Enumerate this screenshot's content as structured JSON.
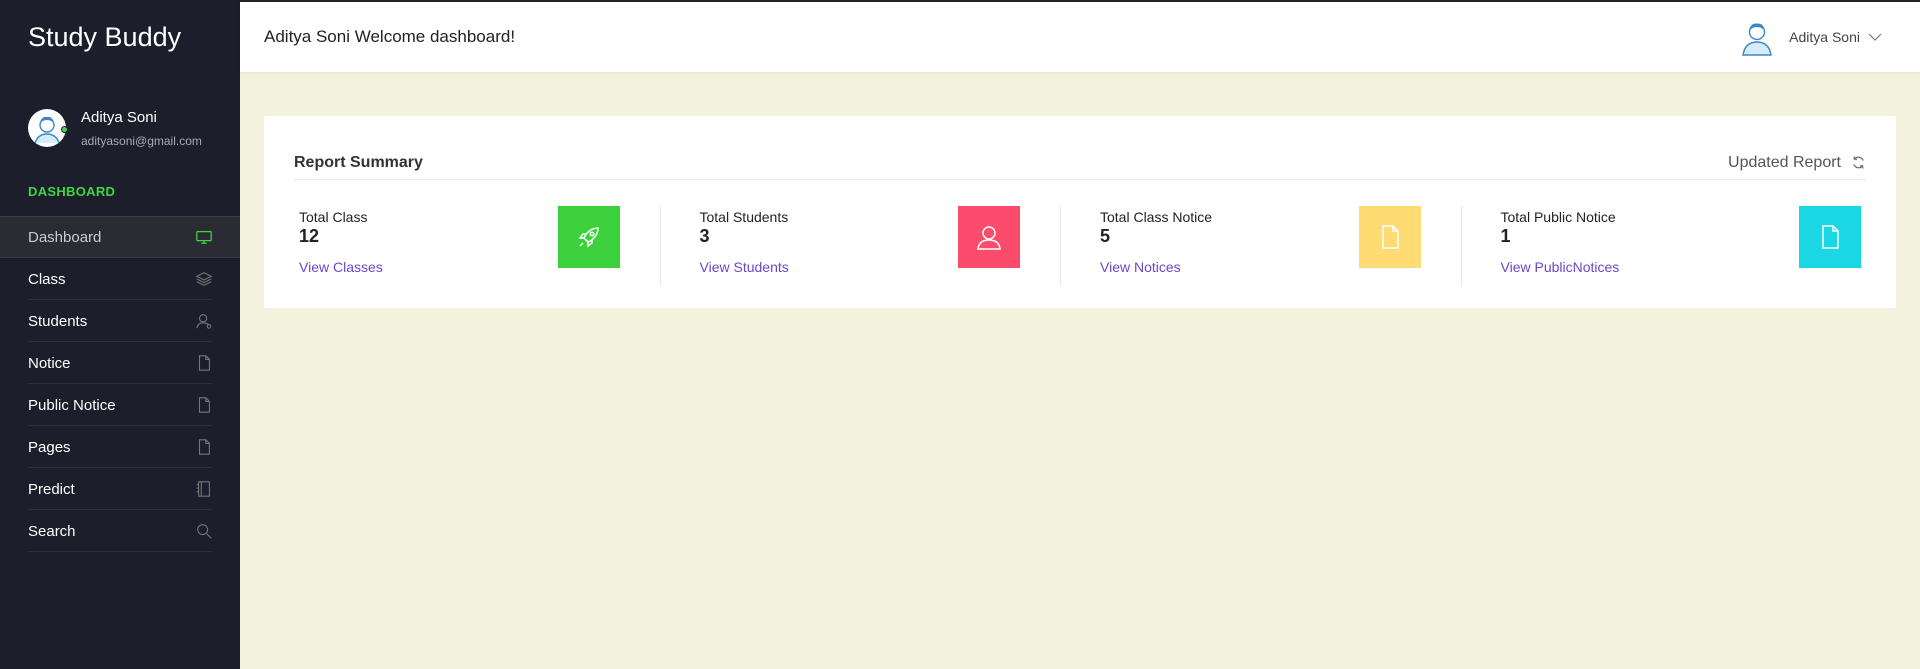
{
  "sidebar": {
    "brand": "Study Buddy",
    "profile": {
      "name": "Aditya Soni",
      "email": "adityasoni@gmail.com"
    },
    "section_label": "DASHBOARD",
    "items": [
      {
        "label": "Dashboard",
        "icon": "monitor-icon",
        "active": true
      },
      {
        "label": "Class",
        "icon": "layers-icon"
      },
      {
        "label": "Students",
        "icon": "user-icon"
      },
      {
        "label": "Notice",
        "icon": "document-icon"
      },
      {
        "label": "Public Notice",
        "icon": "document-icon"
      },
      {
        "label": "Pages",
        "icon": "document-icon"
      },
      {
        "label": "Predict",
        "icon": "notebook-icon"
      },
      {
        "label": "Search",
        "icon": "search-icon"
      }
    ]
  },
  "header": {
    "welcome": "Aditya Soni Welcome dashboard!",
    "user_name": "Aditya Soni"
  },
  "report": {
    "title": "Report Summary",
    "updated_label": "Updated Report",
    "stats": [
      {
        "label": "Total Class",
        "value": "12",
        "link": "View Classes",
        "icon": "rocket-icon",
        "color": "#3cd13c"
      },
      {
        "label": "Total Students",
        "value": "3",
        "link": "View Students",
        "icon": "user-icon",
        "color": "#fc4c6e"
      },
      {
        "label": "Total Class Notice",
        "value": "5",
        "link": "View Notices",
        "icon": "document-icon",
        "color": "#fedb73"
      },
      {
        "label": "Total Public Notice",
        "value": "1",
        "link": "View PublicNotices",
        "icon": "document-icon",
        "color": "#1ad8e3"
      }
    ]
  },
  "colors": {
    "sidebar_bg": "#1c1e2b",
    "accent_green": "#3fd63f",
    "link_purple": "#6b48c9",
    "page_bg": "#f3f3dd"
  }
}
